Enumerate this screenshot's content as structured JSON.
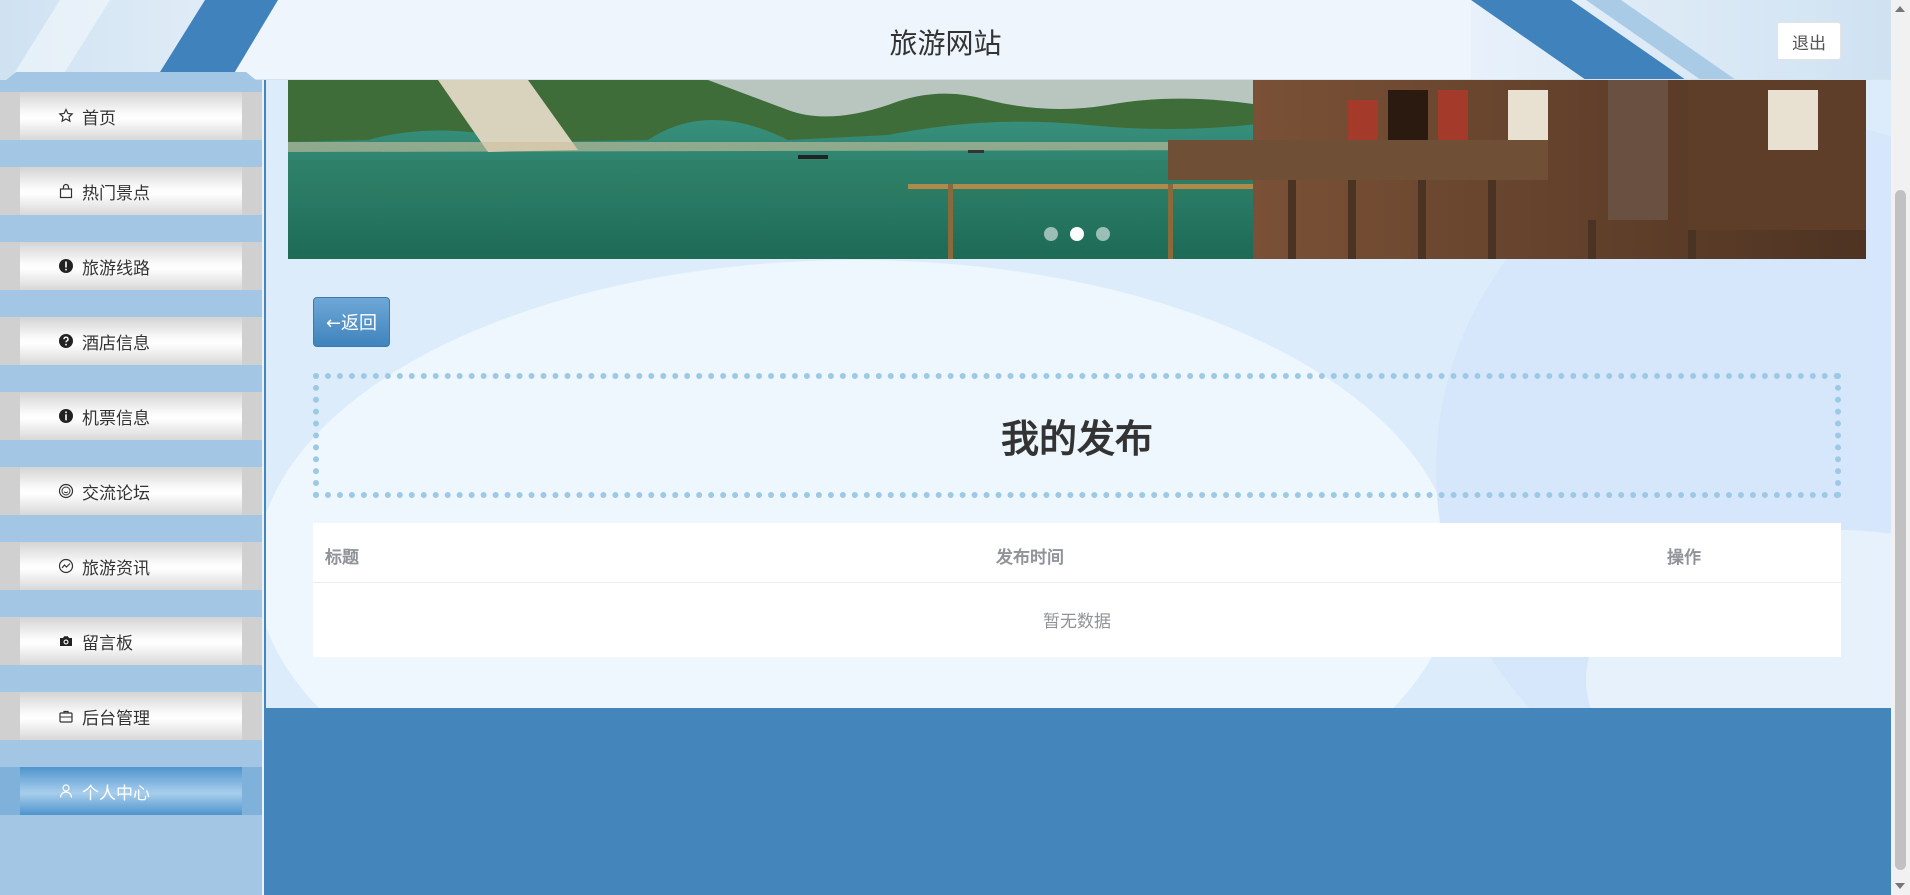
{
  "header": {
    "title": "旅游网站",
    "logout_label": "退出"
  },
  "sidebar": {
    "items": [
      {
        "label": "首页",
        "icon": "star-icon"
      },
      {
        "label": "热门景点",
        "icon": "bag-icon"
      },
      {
        "label": "旅游线路",
        "icon": "exclamation-circle-icon"
      },
      {
        "label": "酒店信息",
        "icon": "question-circle-icon"
      },
      {
        "label": "机票信息",
        "icon": "info-circle-icon"
      },
      {
        "label": "交流论坛",
        "icon": "smile-icon"
      },
      {
        "label": "旅游资讯",
        "icon": "chart-circle-icon"
      },
      {
        "label": "留言板",
        "icon": "camera-icon"
      },
      {
        "label": "后台管理",
        "icon": "briefcase-icon"
      },
      {
        "label": "个人中心",
        "icon": "user-icon",
        "active": true
      }
    ]
  },
  "carousel": {
    "active_index": 1,
    "slide_count": 3
  },
  "main": {
    "back_label": "←返回",
    "page_title": "我的发布",
    "table": {
      "columns": [
        "标题",
        "发布时间",
        "操作"
      ],
      "empty_text": "暂无数据"
    }
  },
  "colors": {
    "accent": "#4486bb",
    "sidebar_bg": "#a3c6e4",
    "content_bg": "#ddecfb",
    "dotted_border": "#9dc9e4"
  }
}
